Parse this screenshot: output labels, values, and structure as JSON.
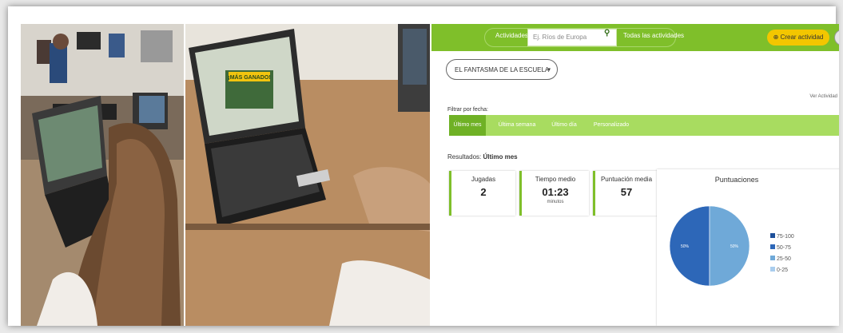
{
  "header": {
    "actividades": "Actividades",
    "search_placeholder": "Ej. Ríos de Europa",
    "todas": "Todas las actividades",
    "crear": "Crear actividad"
  },
  "activity_select": "EL FANTASMA DE LA ESCUELA",
  "ver_actividad": "Ver Actividad",
  "filtro": {
    "label": "Filtrar por fecha:",
    "tabs": [
      "Último mes",
      "Última semana",
      "Último día",
      "Personalizado"
    ]
  },
  "resultados": {
    "prefix": "Resultados:",
    "period": "Último mes"
  },
  "stats": [
    {
      "label": "Jugadas",
      "value": "2",
      "unit": ""
    },
    {
      "label": "Tiempo medio",
      "value": "01:23",
      "unit": "minutos"
    },
    {
      "label": "Puntuación media",
      "value": "57",
      "unit": ""
    }
  ],
  "photo_caption": "¡MÁS GANADO!",
  "chart_data": {
    "type": "pie",
    "title": "Puntuaciones",
    "categories": [
      "75-100",
      "50-75",
      "25-50",
      "0-25"
    ],
    "values": [
      0,
      50,
      50,
      0
    ],
    "slice_labels": [
      "50%",
      "50%"
    ],
    "colors": [
      "#1d4f9a",
      "#2d67b8",
      "#6fa9d8",
      "#a9cdee"
    ],
    "legend_position": "right"
  }
}
